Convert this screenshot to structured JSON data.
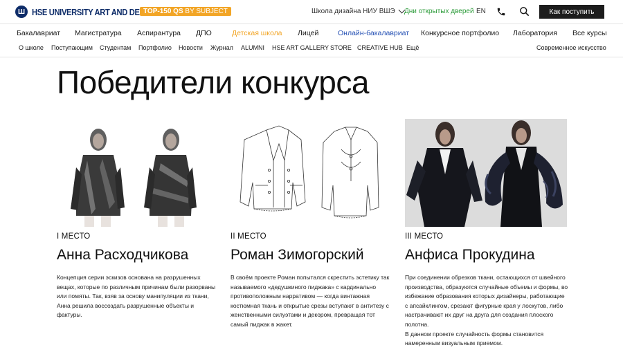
{
  "header": {
    "logo_mark": "Ш",
    "logo_text": "HSE UNIVERSITY ART AND DESIGN",
    "qs_badge_bold": "TOP-150 QS",
    "qs_badge_light": "BY SUBJECT",
    "school_link": "Школа дизайна НИУ ВШЭ",
    "open_days": "Дни открытых дверей",
    "lang": "EN",
    "apply_label": "Как поступить"
  },
  "nav_primary": [
    {
      "label": "Бакалавриат",
      "style": "default"
    },
    {
      "label": "Магистратура",
      "style": "default"
    },
    {
      "label": "Аспирантура",
      "style": "default"
    },
    {
      "label": "ДПО",
      "style": "default"
    },
    {
      "label": "Детская школа",
      "style": "orange"
    },
    {
      "label": "Лицей",
      "style": "default"
    },
    {
      "label": "Онлайн-бакалавриат",
      "style": "blue"
    },
    {
      "label": "Конкурсное портфолио",
      "style": "default"
    },
    {
      "label": "Лаборатория",
      "style": "default"
    },
    {
      "label": "Все курсы",
      "style": "default"
    }
  ],
  "nav_secondary": [
    "О школе",
    "Поступающим",
    "Студентам",
    "Портфолио",
    "Новости",
    "Журнал",
    "ALUMNI",
    "HSE ART GALLERY",
    "STORE",
    "CREATIVE HUB",
    "Ещё"
  ],
  "nav_secondary_right": "Современное искусство",
  "page_title": "Победители конкурса",
  "winners": [
    {
      "place": "I МЕСТО",
      "name": "Анна Расходчикова",
      "description": "Концепция серии эскизов основана на разрушенных вещах, которые по различным причинам были разорваны или помяты. Так, взяв за основу манипуляции из ткани, Анна решила воссоздать разрушенные объекты и фактуры."
    },
    {
      "place": "II МЕСТО",
      "name": "Роман Зимогорский",
      "description": "В своём проекте Роман попытался скрестить эстетику так называемого «дедушкиного пиджака» с кардинально противоположным нарративом — когда винтажная костюмная ткань и открытые срезы вступают в антитезу с женственными силуэтами и декором, превращая тот самый пиджак в жакет."
    },
    {
      "place": "III МЕСТО",
      "name": "Анфиса Прокудина",
      "description": "При соединении обрезков ткани, остающихся от швейного производства, образуются случайные объемы и формы, во избежание образования которых дизайнеры, работающие с апсайклингом, срезают фигурные края у лоскутов, либо настрачивают их друг на друга для создания плоского полотна.\nВ данном проекте случайность формы становится намеренным визуальным приемом."
    }
  ],
  "colors": {
    "brand_blue": "#0f2d69",
    "accent_orange": "#f2a526",
    "link_green": "#2c9b3a",
    "link_blue": "#234fb3",
    "button_dark": "#1c1c1c"
  }
}
